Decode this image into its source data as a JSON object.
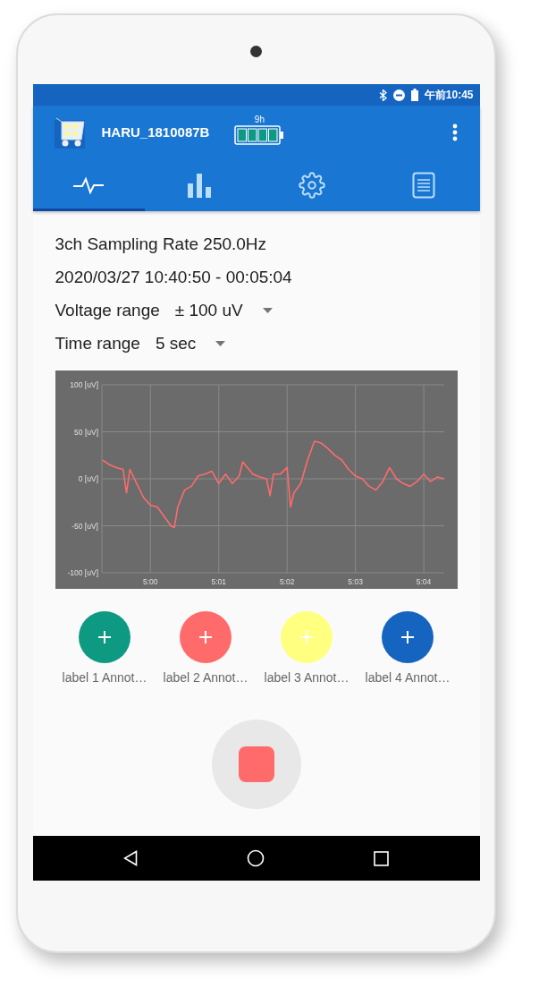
{
  "status_bar": {
    "time": "午前10:45"
  },
  "app_bar": {
    "device_name": "HARU_1810087B",
    "battery_hours": "9h"
  },
  "tabs": [
    {
      "kind": "waveform",
      "selected": true
    },
    {
      "kind": "bars",
      "selected": false
    },
    {
      "kind": "gear",
      "selected": false
    },
    {
      "kind": "list",
      "selected": false
    }
  ],
  "info": {
    "sampling": "3ch Sampling Rate 250.0Hz",
    "recording": "2020/03/27 10:40:50 - 00:05:04"
  },
  "settings": [
    {
      "label": "Voltage range",
      "value": "± 100 uV"
    },
    {
      "label": "Time range",
      "value": "5 sec"
    }
  ],
  "chart_data": {
    "type": "line",
    "grid": true,
    "xlim": [
      299.29,
      304.3
    ],
    "ylim": [
      -100,
      100
    ],
    "xticks": [
      {
        "value": 300,
        "label": "5:00"
      },
      {
        "value": 301,
        "label": "5:01"
      },
      {
        "value": 302,
        "label": "5:02"
      },
      {
        "value": 303,
        "label": "5:03"
      },
      {
        "value": 304,
        "label": "5:04"
      }
    ],
    "yticks": [
      {
        "value": 100,
        "label": "100 [uV]"
      },
      {
        "value": 50,
        "label": "50 [uV]"
      },
      {
        "value": 0,
        "label": "0 [uV]"
      },
      {
        "value": -50,
        "label": "-50 [uV]"
      },
      {
        "value": -100,
        "label": "-100 [uV]"
      }
    ],
    "x": [
      299.3,
      299.4,
      299.5,
      299.6,
      299.65,
      299.7,
      299.8,
      299.9,
      300.0,
      300.1,
      300.2,
      300.3,
      300.35,
      300.4,
      300.5,
      300.6,
      300.7,
      300.8,
      300.9,
      301.0,
      301.1,
      301.2,
      301.3,
      301.35,
      301.5,
      301.6,
      301.7,
      301.75,
      301.8,
      301.9,
      302.0,
      302.05,
      302.1,
      302.2,
      302.3,
      302.4,
      302.5,
      302.6,
      302.7,
      302.8,
      302.9,
      303.0,
      303.1,
      303.2,
      303.3,
      303.4,
      303.5,
      303.6,
      303.7,
      303.8,
      303.9,
      304.0,
      304.1,
      304.2,
      304.3
    ],
    "series": [
      {
        "color": "#ff6b6b",
        "values": [
          20,
          15,
          12,
          10,
          -15,
          10,
          -5,
          -20,
          -28,
          -30,
          -40,
          -50,
          -52,
          -30,
          -12,
          -8,
          3,
          5,
          8,
          -5,
          5,
          -5,
          3,
          18,
          5,
          2,
          0,
          -18,
          5,
          5,
          12,
          -30,
          -15,
          -5,
          20,
          40,
          38,
          32,
          25,
          20,
          10,
          3,
          0,
          -8,
          -12,
          -3,
          12,
          0,
          -5,
          -8,
          -3,
          5,
          -3,
          2,
          0
        ]
      }
    ]
  },
  "annotations": [
    {
      "label": "label 1 Annot…",
      "color": "#0e9a82"
    },
    {
      "label": "label 2 Annot…",
      "color": "#ff6b6b"
    },
    {
      "label": "label 3 Annot…",
      "color": "#ffff80"
    },
    {
      "label": "label 4 Annot…",
      "color": "#1565c0"
    }
  ],
  "stop_button": {
    "recording": true
  }
}
